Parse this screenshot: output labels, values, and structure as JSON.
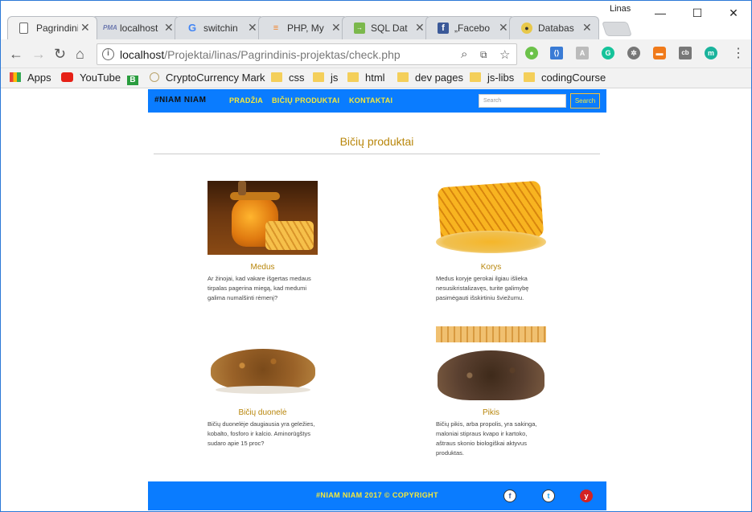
{
  "browser": {
    "profile": "Linas",
    "tabs": [
      {
        "label": "Pagrindini",
        "icon": "page-icon",
        "active": true
      },
      {
        "label": "localhost",
        "icon": "pma-icon"
      },
      {
        "label": "switchin",
        "icon": "google-icon"
      },
      {
        "label": "PHP, My",
        "icon": "stackoverflow-icon"
      },
      {
        "label": "SQL Dat",
        "icon": "sql-icon"
      },
      {
        "label": "„Facebo",
        "icon": "facebook-icon"
      },
      {
        "label": "Databas",
        "icon": "db-icon"
      }
    ],
    "url_host": "localhost",
    "url_path": "/Projektai/linas/Pagrindinis-projektas/check.php",
    "bookmarks": [
      {
        "label": "Apps",
        "icon": "apps-icon"
      },
      {
        "label": "YouTube",
        "icon": "youtube-icon"
      },
      {
        "label": "",
        "icon": "b-icon"
      },
      {
        "label": "CryptoCurrency Mark",
        "icon": "crypto-icon"
      },
      {
        "label": "css",
        "icon": "folder-icon"
      },
      {
        "label": "js",
        "icon": "folder-icon"
      },
      {
        "label": "html",
        "icon": "folder-icon"
      },
      {
        "label": "dev pages",
        "icon": "folder-icon"
      },
      {
        "label": "js-libs",
        "icon": "folder-icon"
      },
      {
        "label": "codingCourse",
        "icon": "folder-icon"
      }
    ]
  },
  "site": {
    "brand": "#NIAM NIAM",
    "nav": [
      "PRADŽIA",
      "BIČIŲ PRODUKTAI",
      "KONTAKTAI"
    ],
    "search_placeholder": "Search",
    "search_button": "Search",
    "heading": "Bičių produktai",
    "products": [
      {
        "title": "Medus",
        "desc": "Ar žinojai, kad vakare išgertas medaus tirpalas pagerina miegą, kad medumi galima numalšinti rėmenį?"
      },
      {
        "title": "Korys",
        "desc": "Medus koryje gerokai ilgiau išlieka nesusikristalizavęs, turite galimybę pasimėgauti išskirtiniu šviežumu."
      },
      {
        "title": "Bičių duonelė",
        "desc": "Bičių duonelėje daugiausia yra geležies, kobalto, fosforo ir kalcio. Aminorūgštys sudaro apie 15 proc?"
      },
      {
        "title": "Pikis",
        "desc": "Bičių pikis, arba propolis, yra sakinga, maloniai stipraus kvapo ir kartoko, aštraus skonio biologiškai aktyvus produktas."
      }
    ],
    "footer": "#NIAM NIAM 2017 © COPYRIGHT",
    "social": [
      "facebook-icon",
      "twitter-icon",
      "yelp-icon"
    ]
  },
  "colors": {
    "nav_bg": "#0a7cff",
    "nav_text": "#f6e93a",
    "accent": "#b8860b"
  }
}
